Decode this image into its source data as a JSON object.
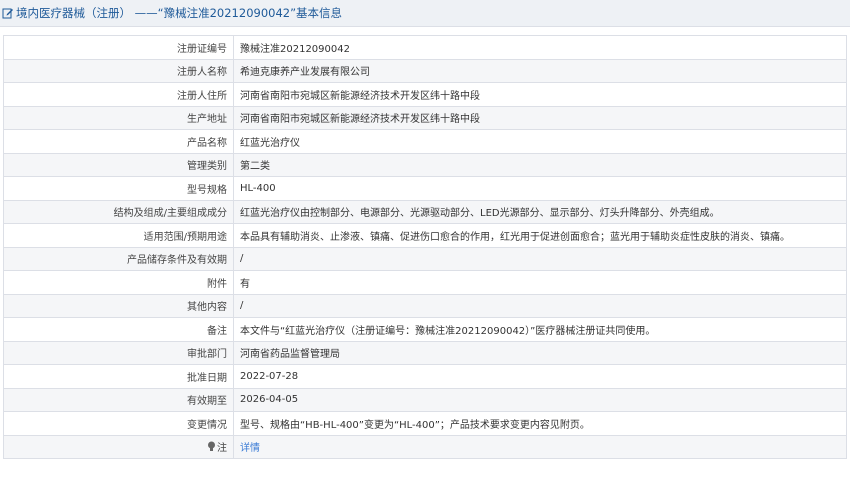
{
  "header": {
    "title": "境内医疗器械（注册） ——“豫械注准20212090042”基本信息",
    "icon": "edit-icon"
  },
  "rows": [
    {
      "label": "注册证编号",
      "value": "豫械注准20212090042"
    },
    {
      "label": "注册人名称",
      "value": "希迪克康养产业发展有限公司"
    },
    {
      "label": "注册人住所",
      "value": "河南省南阳市宛城区新能源经济技术开发区纬十路中段"
    },
    {
      "label": "生产地址",
      "value": "河南省南阳市宛城区新能源经济技术开发区纬十路中段"
    },
    {
      "label": "产品名称",
      "value": "红蓝光治疗仪"
    },
    {
      "label": "管理类别",
      "value": "第二类"
    },
    {
      "label": "型号规格",
      "value": "HL-400"
    },
    {
      "label": "结构及组成/主要组成成分",
      "value": "红蓝光治疗仪由控制部分、电源部分、光源驱动部分、LED光源部分、显示部分、灯头升降部分、外壳组成。"
    },
    {
      "label": "适用范围/预期用途",
      "value": "本品具有辅助消炎、止渗液、镇痛、促进伤口愈合的作用，红光用于促进创面愈合；蓝光用于辅助炎症性皮肤的消炎、镇痛。"
    },
    {
      "label": "产品储存条件及有效期",
      "value": "/"
    },
    {
      "label": "附件",
      "value": "有"
    },
    {
      "label": "其他内容",
      "value": "/"
    },
    {
      "label": "备注",
      "value": "本文件与“红蓝光治疗仪（注册证编号：豫械注准20212090042）”医疗器械注册证共同使用。"
    },
    {
      "label": "审批部门",
      "value": "河南省药品监督管理局"
    },
    {
      "label": "批准日期",
      "value": "2022-07-28"
    },
    {
      "label": "有效期至",
      "value": "2026-04-05"
    },
    {
      "label": "变更情况",
      "value": "型号、规格由“HB-HL-400”变更为“HL-400”；产品技术要求变更内容见附页。"
    }
  ],
  "note_row": {
    "label": "注",
    "icon": "lightbulb-icon",
    "link": "详情"
  },
  "colors": {
    "title": "#1f5a99",
    "link": "#3a7bd5",
    "border": "#dcdfe6",
    "stripe": "#f5f6f8"
  }
}
